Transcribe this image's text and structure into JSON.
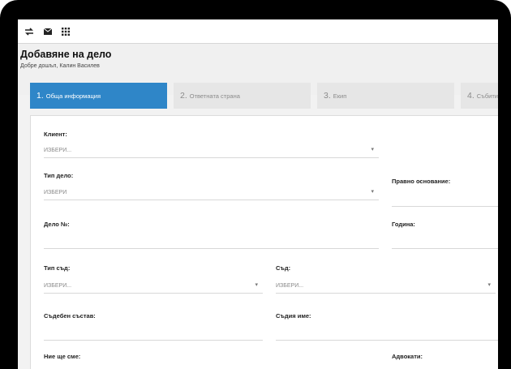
{
  "app": {
    "page_title": "Добавяне на дело",
    "welcome": "Добре дошъл, Калин Василев"
  },
  "toolbar": {
    "icons": [
      "swap-arrows-icon",
      "mail-icon",
      "apps-grid-icon"
    ]
  },
  "steps": [
    {
      "num": "1.",
      "label": "Обща информация",
      "active": true
    },
    {
      "num": "2.",
      "label": "Ответната страна",
      "active": false
    },
    {
      "num": "3.",
      "label": "Екип",
      "active": false
    },
    {
      "num": "4.",
      "label": "Събити",
      "active": false
    }
  ],
  "form": {
    "client_label": "Клиент:",
    "client_value": "ИЗБЕРИ...",
    "case_type_label": "Тип дело:",
    "case_type_value": "ИЗБЕРИ",
    "legal_basis_label": "Правно основание:",
    "case_no_label": "Дело №:",
    "year_label": "Година:",
    "court_type_label": "Тип съд:",
    "court_type_value": "ИЗБЕРИ...",
    "court_label": "Съд:",
    "court_value": "ИЗБЕРИ...",
    "panel_label": "Съдебен състав:",
    "judge_label": "Съдия име:",
    "we_are_label": "Ние ще сме:",
    "lawyers_label": "Адвокати:",
    "dropdown_arrow": "▾"
  },
  "colors": {
    "active_step": "#2f86c8",
    "inactive_step": "#e6e6e6",
    "frame": "#000000"
  }
}
